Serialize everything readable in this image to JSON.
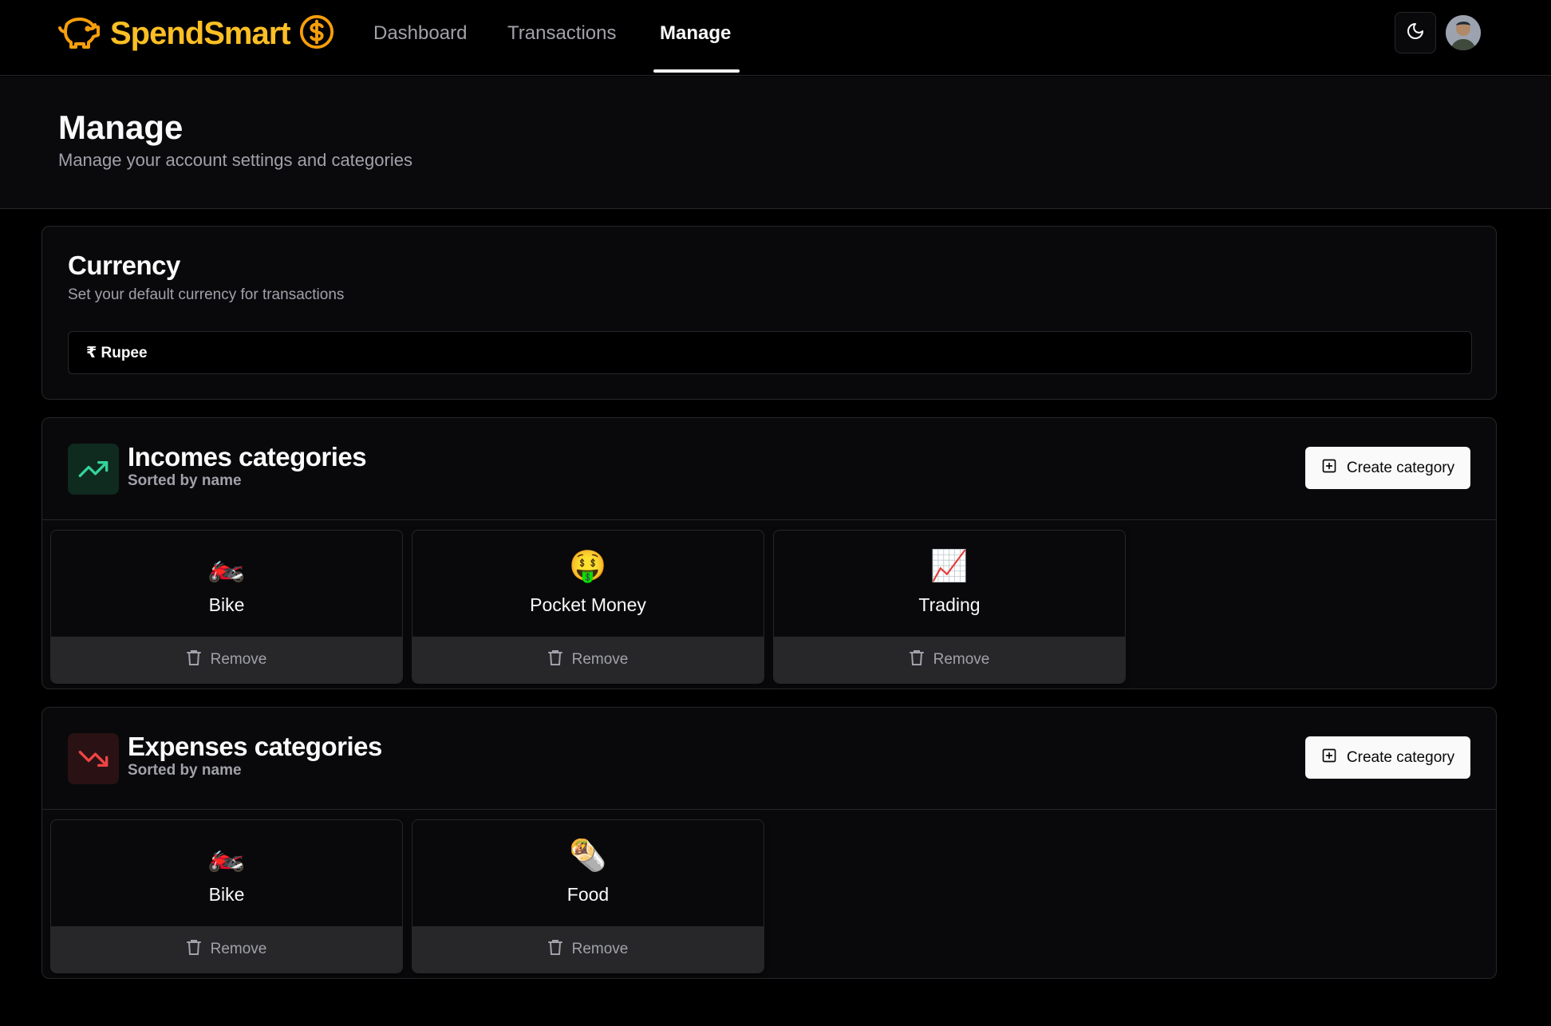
{
  "app": {
    "name": "SpendSmart"
  },
  "nav": {
    "links": [
      {
        "label": "Dashboard"
      },
      {
        "label": "Transactions"
      },
      {
        "label": "Manage"
      }
    ],
    "active": "Manage"
  },
  "page": {
    "title": "Manage",
    "subtitle": "Manage your account settings and categories"
  },
  "currency": {
    "title": "Currency",
    "description": "Set your default currency for transactions",
    "selected": "₹ Rupee"
  },
  "income": {
    "title": "Incomes categories",
    "subtitle": "Sorted by name",
    "create_label": "Create category",
    "items": [
      {
        "emoji": "🏍️",
        "name": "Bike",
        "remove_label": "Remove"
      },
      {
        "emoji": "🤑",
        "name": "Pocket Money",
        "remove_label": "Remove"
      },
      {
        "emoji": "📈",
        "name": "Trading",
        "remove_label": "Remove"
      }
    ]
  },
  "expense": {
    "title": "Expenses categories",
    "subtitle": "Sorted by name",
    "create_label": "Create category",
    "items": [
      {
        "emoji": "🏍️",
        "name": "Bike",
        "remove_label": "Remove"
      },
      {
        "emoji": "🌯",
        "name": "Food",
        "remove_label": "Remove"
      }
    ]
  },
  "colors": {
    "brand": "#fbbf24",
    "income": "#34d399",
    "expense": "#ef4444",
    "background": "#000000"
  }
}
